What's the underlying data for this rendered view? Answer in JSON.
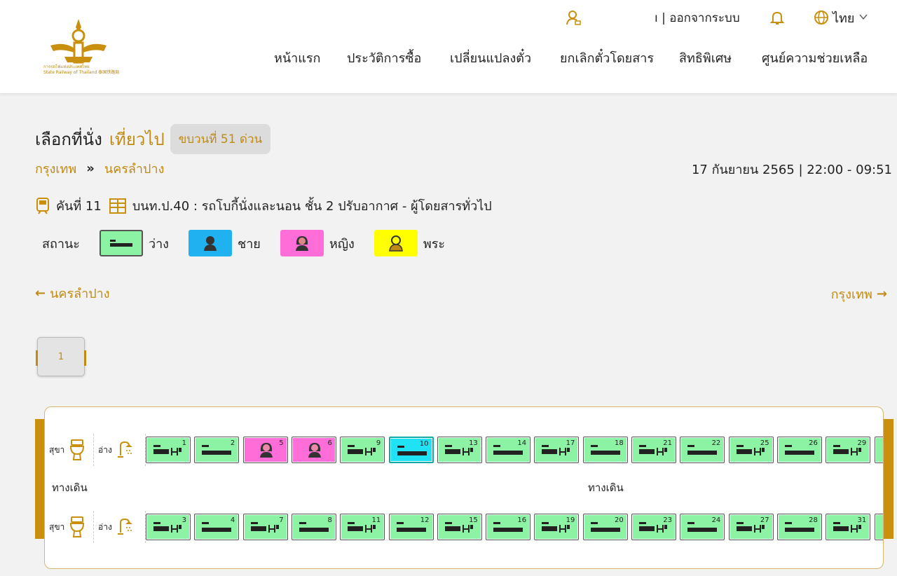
{
  "header": {
    "logo_text_th": "การรถไฟแห่งประเทศไทย",
    "logo_text_en": "State Railway of Thailand 泰国铁路局",
    "user_label": "ı | ออกจากระบบ",
    "lang": "ไทย",
    "nav": [
      {
        "label": "หน้าแรก"
      },
      {
        "label": "ประวัติการซื้อ"
      },
      {
        "label": "เปลี่ยนแปลงตั๋ว"
      },
      {
        "label": "ยกเลิกตั๋วโดยสาร"
      },
      {
        "label": "สิทธิพิเศษ"
      },
      {
        "label": "ศูนย์ความช่วยเหลือ"
      }
    ]
  },
  "trip": {
    "title": "เลือกที่นั่ง",
    "direction": "เที่ยวไป",
    "train": "ขบวนที่ 51 ด่วน",
    "origin": "กรุงเทพ",
    "destination": "นครลำปาง",
    "date_time": "17 กันยายน 2565 | 22:00 - 09:51",
    "car_no": "คันที่ 11",
    "car_desc": "บนท.ป.40 : รถโบกี้นั่งและนอน ชั้น 2 ปรับอากาศ - ผู้โดยสารทั่วไป"
  },
  "legend": {
    "label": "สถานะ",
    "available": "ว่าง",
    "male": "ชาย",
    "female": "หญิง",
    "monk": "พระ",
    "colors": {
      "available": "#8bf3a3",
      "male": "#1fb1f0",
      "female": "#ff6ed8",
      "monk": "#ffff00",
      "selected": "#1fe3f5",
      "accent": "#c08b14"
    }
  },
  "direction_nav": {
    "left": "นครลำปาง",
    "right": "กรุงเทพ"
  },
  "pagination": {
    "current": "1"
  },
  "coach": {
    "toilet": "สุขา",
    "sink": "อ่าง",
    "aisle": "ทางเดิน",
    "top_row": [
      {
        "num": "1",
        "type": "lower",
        "status": "available"
      },
      {
        "num": "2",
        "type": "upper",
        "status": "available"
      },
      {
        "num": "5",
        "type": "upper",
        "status": "female"
      },
      {
        "num": "6",
        "type": "upper",
        "status": "female"
      },
      {
        "num": "9",
        "type": "lower",
        "status": "available"
      },
      {
        "num": "10",
        "type": "upper",
        "status": "selected"
      },
      {
        "num": "13",
        "type": "lower",
        "status": "available"
      },
      {
        "num": "14",
        "type": "upper",
        "status": "available"
      },
      {
        "num": "17",
        "type": "lower",
        "status": "available"
      },
      {
        "num": "18",
        "type": "upper",
        "status": "available"
      },
      {
        "num": "21",
        "type": "lower",
        "status": "available"
      },
      {
        "num": "22",
        "type": "upper",
        "status": "available"
      },
      {
        "num": "25",
        "type": "lower",
        "status": "available"
      },
      {
        "num": "26",
        "type": "upper",
        "status": "available"
      },
      {
        "num": "29",
        "type": "lower",
        "status": "available"
      }
    ],
    "bottom_row": [
      {
        "num": "3",
        "type": "lower",
        "status": "available"
      },
      {
        "num": "4",
        "type": "upper",
        "status": "available"
      },
      {
        "num": "7",
        "type": "lower",
        "status": "available"
      },
      {
        "num": "8",
        "type": "upper",
        "status": "available"
      },
      {
        "num": "11",
        "type": "lower",
        "status": "available"
      },
      {
        "num": "12",
        "type": "upper",
        "status": "available"
      },
      {
        "num": "15",
        "type": "lower",
        "status": "available"
      },
      {
        "num": "16",
        "type": "upper",
        "status": "available"
      },
      {
        "num": "19",
        "type": "lower",
        "status": "available"
      },
      {
        "num": "20",
        "type": "upper",
        "status": "available"
      },
      {
        "num": "23",
        "type": "lower",
        "status": "available"
      },
      {
        "num": "24",
        "type": "upper",
        "status": "available"
      },
      {
        "num": "27",
        "type": "lower",
        "status": "available"
      },
      {
        "num": "28",
        "type": "upper",
        "status": "available"
      },
      {
        "num": "31",
        "type": "lower",
        "status": "available"
      }
    ]
  }
}
